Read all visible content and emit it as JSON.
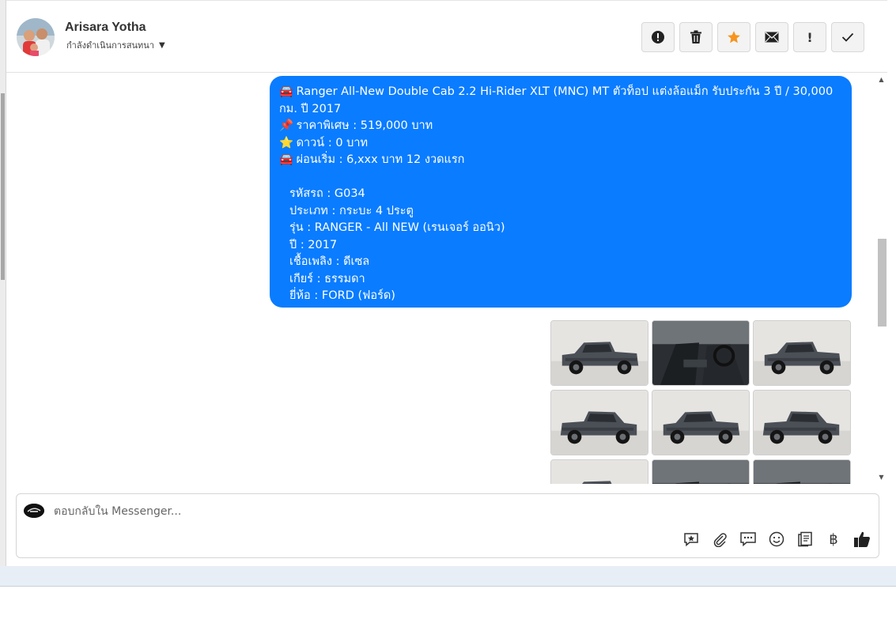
{
  "header": {
    "contact_name": "Arisara Yotha",
    "conversation_status": "กำลังดำเนินการสนทนา"
  },
  "actions": [
    {
      "name": "alert-button",
      "icon": "exclamation-circle-icon"
    },
    {
      "name": "delete-button",
      "icon": "trash-icon"
    },
    {
      "name": "star-button",
      "icon": "star-icon",
      "color": "#f7941d"
    },
    {
      "name": "mail-button",
      "icon": "envelope-icon"
    },
    {
      "name": "important-button",
      "icon": "exclamation-icon",
      "text": "!"
    },
    {
      "name": "done-button",
      "icon": "check-icon"
    }
  ],
  "message": {
    "bubble_color": "#0a7cff",
    "lines": [
      "Ranger All-New Double Cab 2.2 Hi-Rider XLT (MNC) MT ตัวท็อป แต่งล้อแม็ก รับประกัน 3 ปี / 30,000 กม. ปี 2017",
      "ราคาพิเศษ : 519,000 บาท",
      "ดาวน์ : 0 บาท",
      "ผ่อนเริ่ม : 6,xxx บาท 12 งวดแรก",
      "รหัสรถ : G034",
      "ประเภท : กระบะ 4 ประตู",
      "รุ่น : RANGER - All NEW (เรนเจอร์ ออนิว)",
      "ปี : 2017",
      "เชื้อเพลิง : ดีเซล",
      "เกียร์ : ธรรมดา",
      "ยี่ห้อ : FORD (ฟอร์ด)"
    ],
    "emoji": {
      "car": "🚘",
      "pin": "📌",
      "star": "⭐"
    }
  },
  "gallery": {
    "photos": [
      {
        "view": "front"
      },
      {
        "view": "interior"
      },
      {
        "view": "front-three-quarter"
      },
      {
        "view": "rear-three-quarter"
      },
      {
        "view": "rear"
      },
      {
        "view": "side"
      },
      {
        "view": "side-low"
      },
      {
        "view": "console"
      },
      {
        "view": "dashboard"
      }
    ]
  },
  "composer": {
    "placeholder": "ตอบกลับใน Messenger...",
    "tools": [
      "saved-reply-icon",
      "attachment-icon",
      "chat-bubbles-icon",
      "emoji-icon",
      "notes-icon",
      "baht-icon",
      "like-icon"
    ],
    "baht_symbol": "฿"
  }
}
